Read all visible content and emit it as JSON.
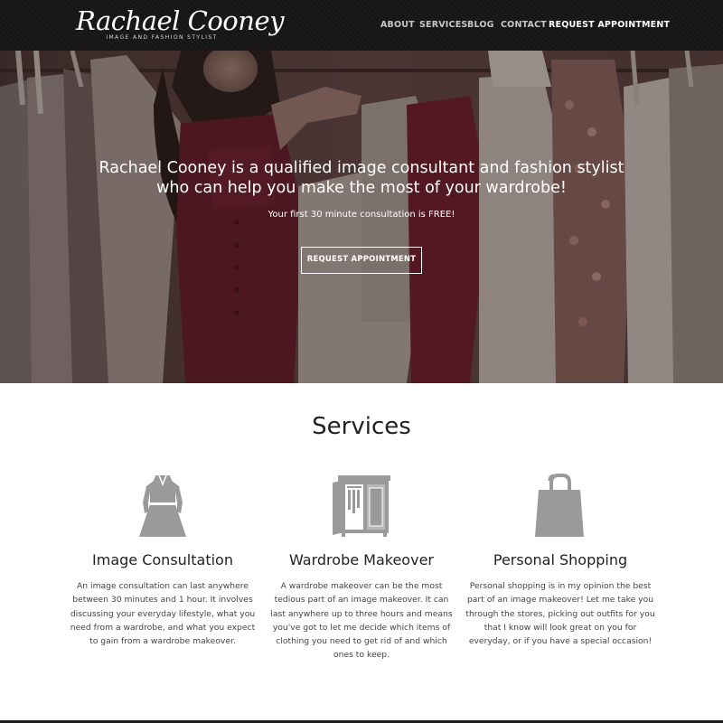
{
  "header": {
    "logo_name": "Rachael Cooney",
    "logo_tagline": "IMAGE AND FASHION STYLIST",
    "nav": {
      "about": "ABOUT",
      "services": "SERVICES",
      "blog": "BLOG",
      "contact": "CONTACT",
      "request": "REQUEST APPOINTMENT"
    }
  },
  "hero": {
    "title": "Rachael Cooney is a qualified image consultant and fashion stylist who can help you make the most of your wardrobe!",
    "subtitle": "Your first 30 minute consultation is FREE!",
    "button_label": "REQUEST APPOINTMENT"
  },
  "services": {
    "heading": "Services",
    "items": [
      {
        "icon": "dress-icon",
        "title": "Image Consultation",
        "description": "An image consultation can last anywhere between 30 minutes and 1 hour. It involves discussing your everyday lifestyle, what you need from a wardrobe, and what you expect to gain from a wardrobe makeover."
      },
      {
        "icon": "wardrobe-icon",
        "title": "Wardrobe Makeover",
        "description": "A wardrobe makeover can be the most tedious part of an image makeover. It can last anywhere up to three hours and means you've got to let me decide which items of clothing you need to get rid of and which ones to keep."
      },
      {
        "icon": "shopping-bag-icon",
        "title": "Personal Shopping",
        "description": "Personal shopping is in my opinion the best part of an image makeover! Let me take you through the stores, picking out outfits for you that I know will look great on you for everyday, or if you have a special occasion!"
      }
    ]
  },
  "colors": {
    "header_bg": "#161616",
    "icon_gray": "#9a9a9a",
    "accent_burgundy": "#6e1a2e"
  }
}
